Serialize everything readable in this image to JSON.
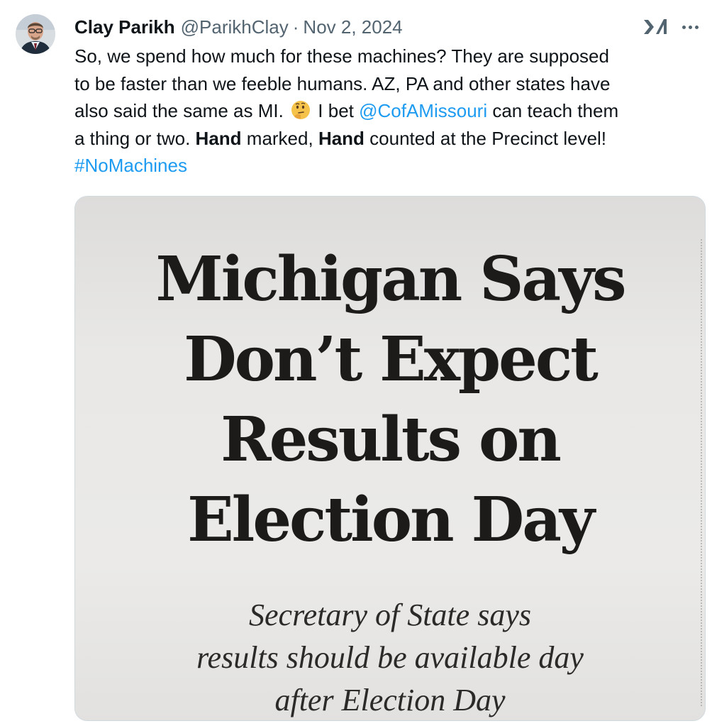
{
  "author": {
    "name": "Clay Parikh",
    "handle": "@ParikhClay",
    "separator": "·",
    "date": "Nov 2, 2024"
  },
  "icons": {
    "brand": "x-logo-icon",
    "more": "more-options-icon",
    "emoji": "thinking-face-emoji"
  },
  "tweet": {
    "line1": "So, we spend how much for these machines? They are supposed",
    "line2": "to be faster than we feeble humans. AZ, PA and other states have",
    "line3_a": "also said the same as MI.",
    "line3_b": "I bet",
    "mention": "@CofAMissouri",
    "line3_c": "can teach them",
    "line4_a": "a thing or two.",
    "bold1": "Hand",
    "line4_b": "marked,",
    "bold2": "Hand",
    "line4_c": "counted at the Precinct level!",
    "hashtag": "#NoMachines"
  },
  "image": {
    "headline": [
      "Michigan Says",
      "Don’t Expect",
      "Results on",
      "Election Day"
    ],
    "subhead": [
      "Secretary of State says",
      "results should be available day",
      "after Election Day"
    ]
  },
  "colors": {
    "link": "#1d9bf0",
    "text": "#0f1419",
    "muted": "#536471"
  }
}
